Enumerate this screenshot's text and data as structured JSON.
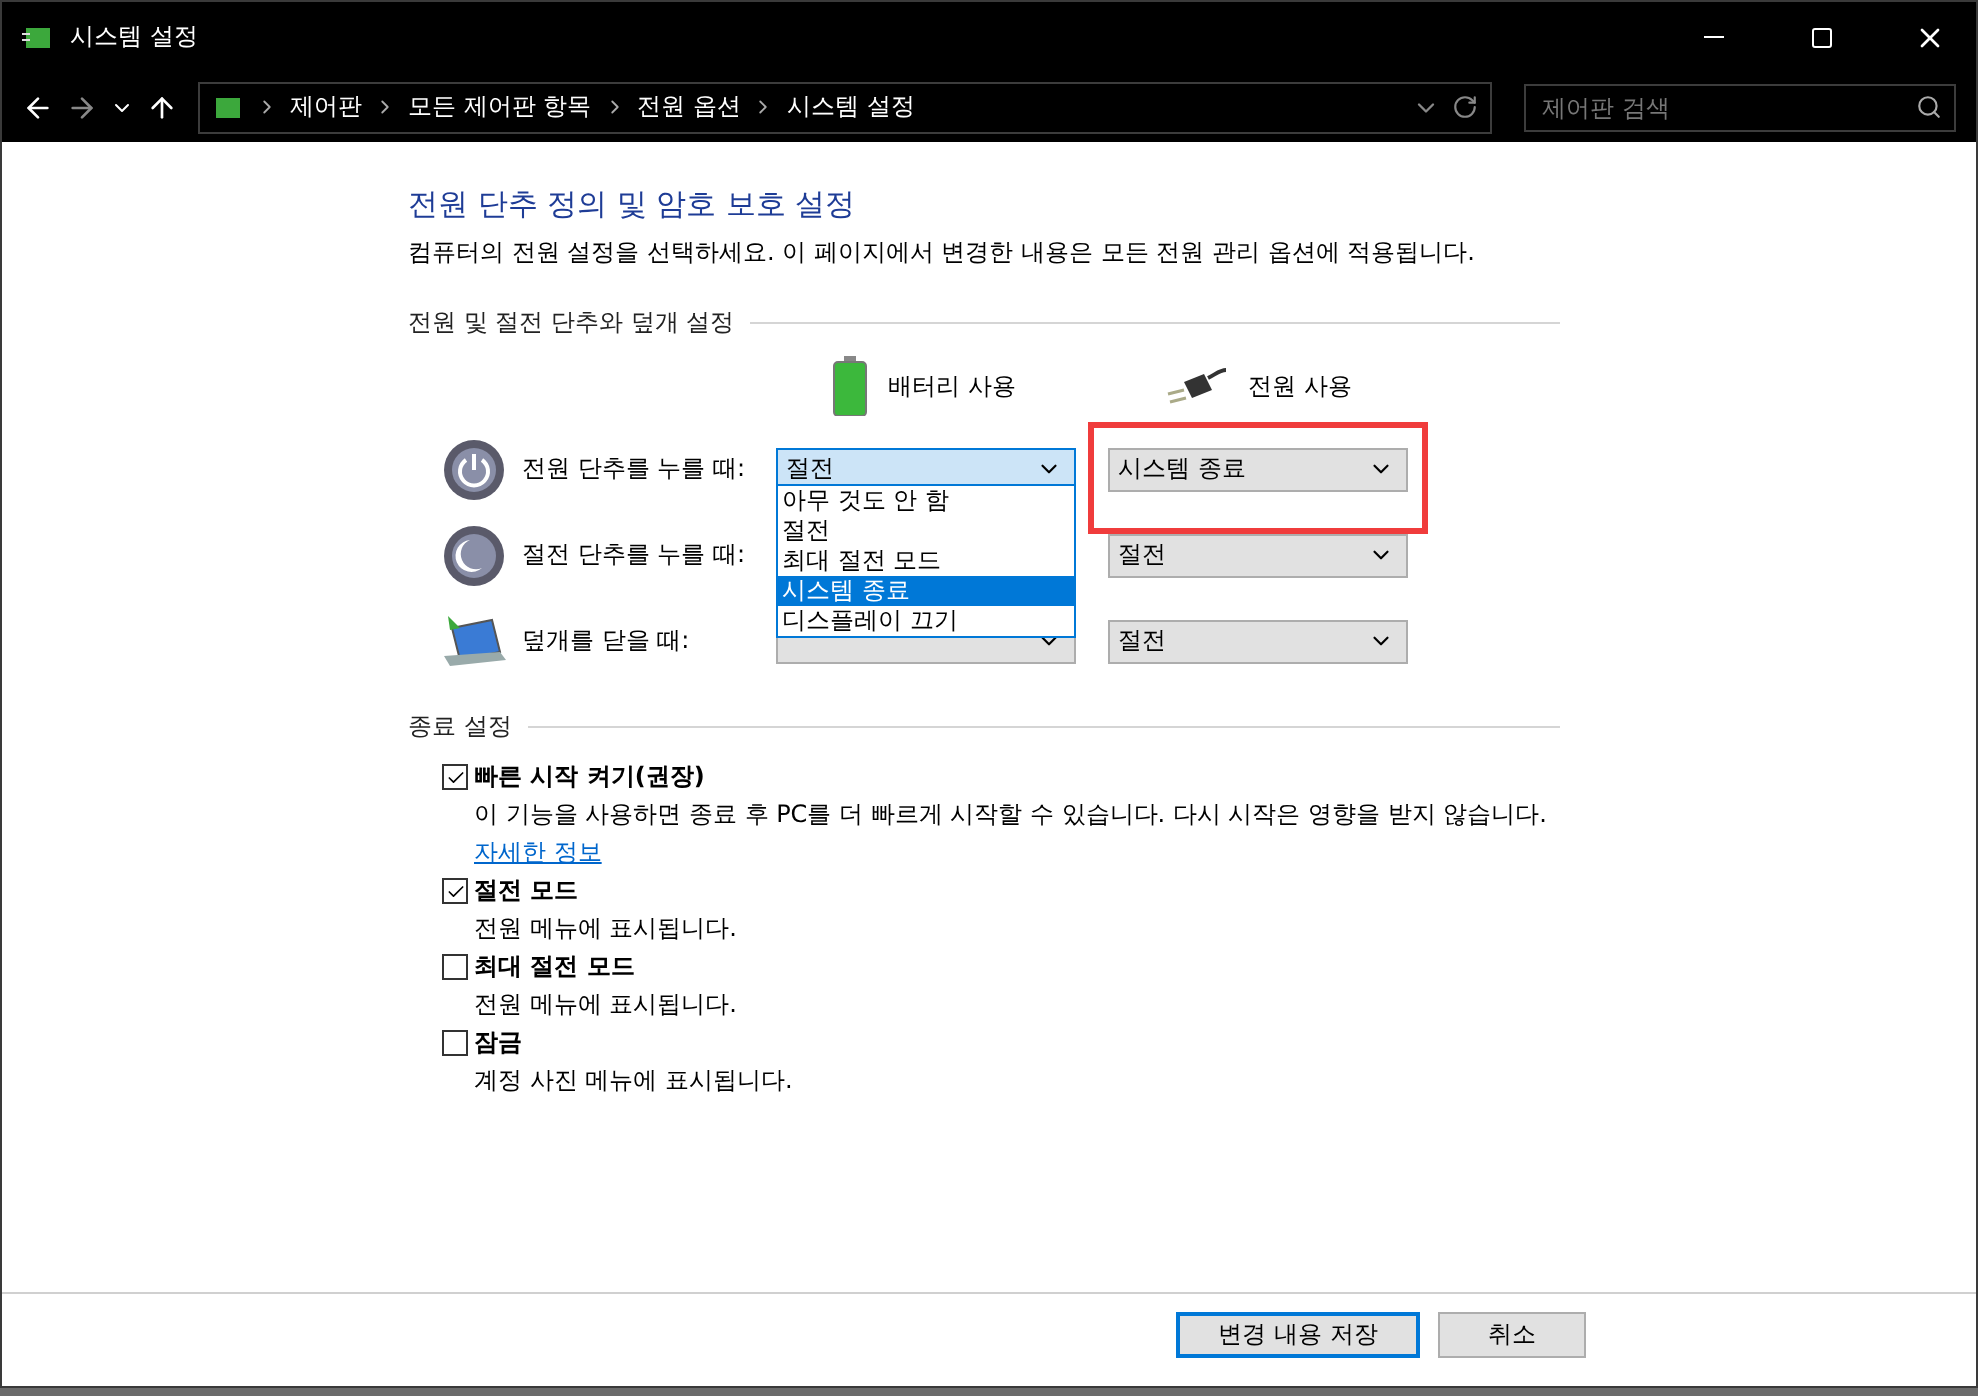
{
  "window": {
    "title": "시스템 설정"
  },
  "address_bar": {
    "crumbs": [
      "제어판",
      "모든 제어판 항목",
      "전원 옵션",
      "시스템 설정"
    ],
    "search_placeholder": "제어판 검색"
  },
  "heading": "전원 단추 정의 및 암호 보호 설정",
  "intro": "컴퓨터의 전원 설정을 선택하세요. 이 페이지에서 변경한 내용은 모든 전원 관리 옵션에 적용됩니다.",
  "buttons_section": {
    "title": "전원 및 절전 단추와 덮개 설정",
    "columns": [
      "배터리 사용",
      "전원 사용"
    ],
    "rows": [
      {
        "kind": "power",
        "label": "전원 단추를 누를 때:",
        "battery": {
          "value": "절전",
          "open": true
        },
        "plugged": {
          "value": "시스템 종료",
          "highlighted": true
        }
      },
      {
        "kind": "sleep",
        "label": "절전 단추를 누를 때:",
        "plugged": {
          "value": "절전",
          "highlighted": false
        }
      },
      {
        "kind": "lid",
        "label": "덮개를 닫을 때:",
        "battery": {
          "open": false
        },
        "plugged": {
          "value": "절전",
          "highlighted": false
        }
      }
    ],
    "dropdown_options": [
      {
        "label": "아무 것도 안 함",
        "selected": false
      },
      {
        "label": "절전",
        "selected": false
      },
      {
        "label": "최대 절전 모드",
        "selected": false
      },
      {
        "label": "시스템 종료",
        "selected": true
      },
      {
        "label": "디스플레이 끄기",
        "selected": false
      }
    ]
  },
  "shutdown_section": {
    "title": "종료 설정",
    "options": [
      {
        "label": "빠른 시작 켜기(권장)",
        "checked": true,
        "description": "이 기능을 사용하면 종료 후 PC를 더 빠르게 시작할 수 있습니다. 다시 시작은 영향을 받지 않습니다.",
        "link": "자세한 정보"
      },
      {
        "label": "절전 모드",
        "checked": true,
        "description": "전원 메뉴에 표시됩니다."
      },
      {
        "label": "최대 절전 모드",
        "checked": false,
        "description": "전원 메뉴에 표시됩니다."
      },
      {
        "label": "잠금",
        "checked": false,
        "description": "계정 사진 메뉴에 표시됩니다."
      }
    ]
  },
  "footer": {
    "save": "변경 내용 저장",
    "cancel": "취소"
  }
}
